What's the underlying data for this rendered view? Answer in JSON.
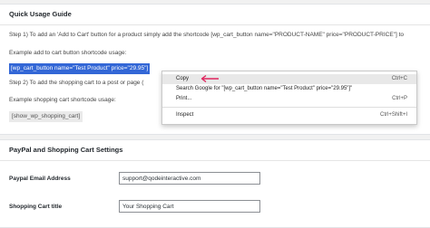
{
  "guide": {
    "title": "Quick Usage Guide",
    "step1": "Step 1) To add an 'Add to Cart' button for a product simply add the shortcode [wp_cart_button name=\"PRODUCT-NAME\" price=\"PRODUCT-PRICE\"] to",
    "example_add_label": "Example add to cart button shortcode usage:",
    "example_add_code": "[wp_cart_button name=\"Test Product\" price=\"29.95\"]",
    "step2": "Step 2) To add the shopping cart to a post or page (",
    "example_cart_label": "Example shopping cart shortcode usage:",
    "example_cart_code": "[show_wp_shopping_cart]"
  },
  "context_menu": {
    "items": [
      {
        "label": "Copy",
        "shortcut": "Ctrl+C"
      },
      {
        "label": "Search Google for \"[wp_cart_button name=\"Test Product\" price=\"29.95\"]\"",
        "shortcut": ""
      },
      {
        "label": "Print...",
        "shortcut": "Ctrl+P"
      },
      {
        "label": "Inspect",
        "shortcut": "Ctrl+Shift+I"
      }
    ],
    "highlighted_item": "Copy",
    "arrow_color": "#e0245e"
  },
  "settings": {
    "title": "PayPal and Shopping Cart Settings",
    "email_label": "Paypal Email Address",
    "email_value": "support@qodeinteractive.com",
    "cart_title_label": "Shopping Cart title",
    "cart_title_value": "Your Shopping Cart"
  }
}
